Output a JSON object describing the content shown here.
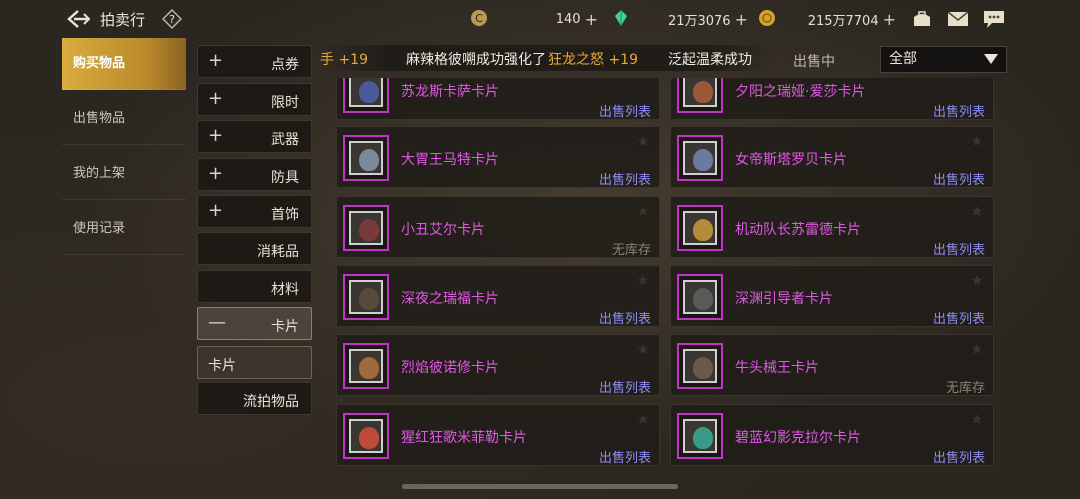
{
  "header": {
    "title": "拍卖行",
    "currencies": [
      {
        "icon": "coin-c-icon",
        "value": "140"
      },
      {
        "icon": "green-crystal-icon",
        "value": "21万3076"
      },
      {
        "icon": "gold-coin-icon",
        "value": "215万7704"
      }
    ],
    "plus": "+"
  },
  "nav": {
    "items": [
      {
        "label": "购买物品",
        "active": true
      },
      {
        "label": "出售物品",
        "active": false
      },
      {
        "label": "我的上架",
        "active": false
      },
      {
        "label": "使用记录",
        "active": false
      }
    ]
  },
  "categories": [
    {
      "label": "点券",
      "sign": "+"
    },
    {
      "label": "限时",
      "sign": "+"
    },
    {
      "label": "武器",
      "sign": "+"
    },
    {
      "label": "防具",
      "sign": "+"
    },
    {
      "label": "首饰",
      "sign": "+"
    },
    {
      "label": "消耗品",
      "sign": ""
    },
    {
      "label": "材料",
      "sign": ""
    },
    {
      "label": "卡片",
      "sign": "—"
    },
    {
      "label": "卡片",
      "sign": ""
    },
    {
      "label": "流拍物品",
      "sign": ""
    }
  ],
  "ticker": {
    "part1": "手 +19",
    "part2": "麻辣格彼嗍成功强化了",
    "part3": "狂龙之怒 +19",
    "part4": "泛起温柔成功",
    "accent": "#e8a73a"
  },
  "filter": {
    "sell_label": "出售中",
    "selected": "全部"
  },
  "items": [
    {
      "name": "苏龙斯卡萨卡片",
      "status": "出售列表",
      "face": "#4a5a9a"
    },
    {
      "name": "夕阳之瑞娅·爱莎卡片",
      "status": "出售列表",
      "face": "#9a5a3a"
    },
    {
      "name": "大胃王马特卡片",
      "status": "出售列表",
      "face": "#7a8a9a"
    },
    {
      "name": "女帝斯塔罗贝卡片",
      "status": "出售列表",
      "face": "#6a7aa0"
    },
    {
      "name": "小丑艾尔卡片",
      "status": "无库存",
      "face": "#7a3a3a"
    },
    {
      "name": "机动队长苏雷德卡片",
      "status": "出售列表",
      "face": "#b58a3a"
    },
    {
      "name": "深夜之瑞福卡片",
      "status": "出售列表",
      "face": "#5a4a3a"
    },
    {
      "name": "深渊引导者卡片",
      "status": "出售列表",
      "face": "#5a5a5a"
    },
    {
      "name": "烈焰彼诺修卡片",
      "status": "出售列表",
      "face": "#a06a3a"
    },
    {
      "name": "牛头械王卡片",
      "status": "无库存",
      "face": "#6a5a4a"
    },
    {
      "name": "猩红狂歌米菲勒卡片",
      "status": "出售列表",
      "face": "#c04a3a"
    },
    {
      "name": "碧蓝幻影克拉尔卡片",
      "status": "出售列表",
      "face": "#3a9a8a"
    }
  ],
  "colors": {
    "magenta": "#e158e6",
    "status_blue": "#8e8cf4",
    "nav_active": "#d8ad3d"
  }
}
